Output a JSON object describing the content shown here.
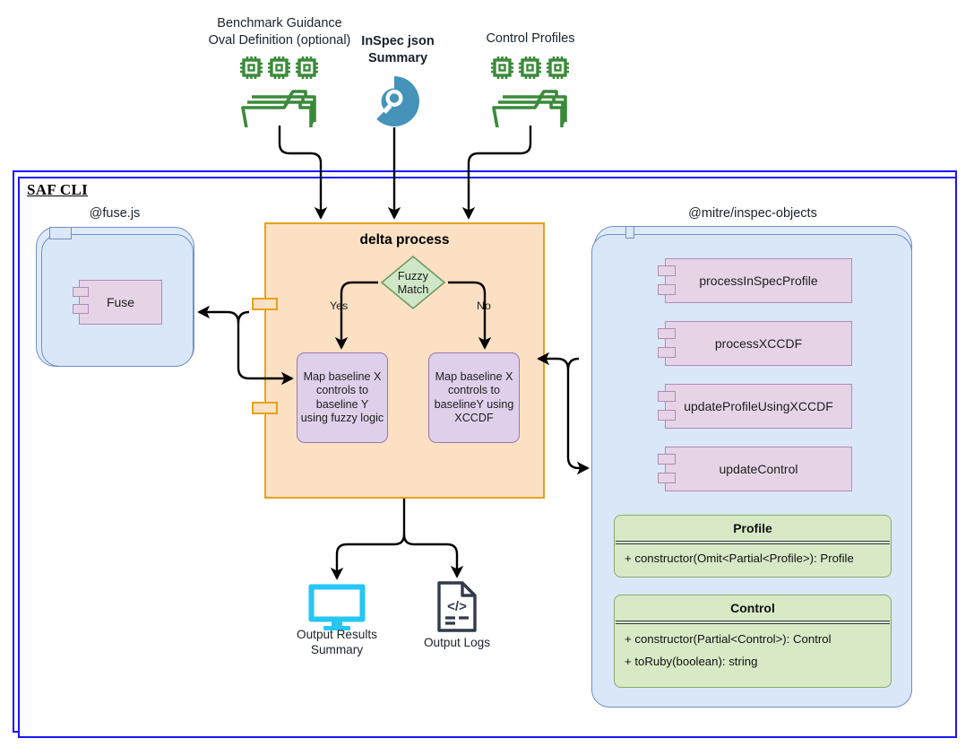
{
  "sources": [
    {
      "label_lines": [
        "Benchmark Guidance",
        "Oval Definition (optional)"
      ],
      "icon": "folder-stack-chips-icon",
      "bold": false
    },
    {
      "label_lines": [
        "InSpec json",
        "Summary"
      ],
      "icon": "inspec-logo-icon",
      "bold": true
    },
    {
      "label_lines": [
        "Control Profiles"
      ],
      "icon": "folder-stack-chips-icon",
      "bold": false
    }
  ],
  "saf_cli": {
    "title": "SAF CLI"
  },
  "fuse_package": {
    "caption": "@fuse.js",
    "component": {
      "label": "Fuse"
    }
  },
  "delta": {
    "title": "delta process",
    "decision": {
      "lines": [
        "Fuzzy",
        "Match"
      ]
    },
    "edge_labels": {
      "yes": "Yes",
      "no": "No"
    },
    "tasks": [
      {
        "lines": [
          "Map baseline X",
          "controls to",
          "baseline Y",
          "using fuzzy logic"
        ]
      },
      {
        "lines": [
          "Map baseline X",
          "controls to",
          "baselineY using",
          "XCCDF"
        ]
      }
    ]
  },
  "inspec_objects_package": {
    "caption": "@mitre/inspec-objects",
    "components": [
      {
        "label": "processInSpecProfile"
      },
      {
        "label": "processXCCDF"
      },
      {
        "label": "updateProfileUsingXCCDF"
      },
      {
        "label": "updateControl"
      }
    ],
    "classes": [
      {
        "name": "Profile",
        "members": [
          "+ constructor(Omit<Partial<Profile>): Profile"
        ]
      },
      {
        "name": "Control",
        "members": [
          "+ constructor(Partial<Control>): Control",
          "+ toRuby(boolean): string"
        ]
      }
    ]
  },
  "outputs": [
    {
      "icon": "monitor-icon",
      "label_lines": [
        "Output Results",
        "Summary"
      ]
    },
    {
      "icon": "code-document-icon",
      "label_lines": [
        "Output Logs"
      ]
    }
  ],
  "colors": {
    "saf_border": "#1a16ff",
    "package_fill": "#dae7f8",
    "package_border": "#6f8fc4",
    "delta_fill": "#fbe0c3",
    "delta_border": "#e5a316",
    "task_fill": "#ded0ea",
    "task_border": "#9a77ad",
    "component_fill": "#e6d4e6",
    "component_border": "#b08ab9",
    "class_fill": "#d8e9c6",
    "class_border": "#87ab6b",
    "diamond_fill": "#cfe7c6",
    "folder_icon": "#3a8a3a",
    "inspec_icon": "#4593b8",
    "monitor_icon": "#26c6f5",
    "doc_icon": "#2f3b4a",
    "arrow": "#000000"
  }
}
